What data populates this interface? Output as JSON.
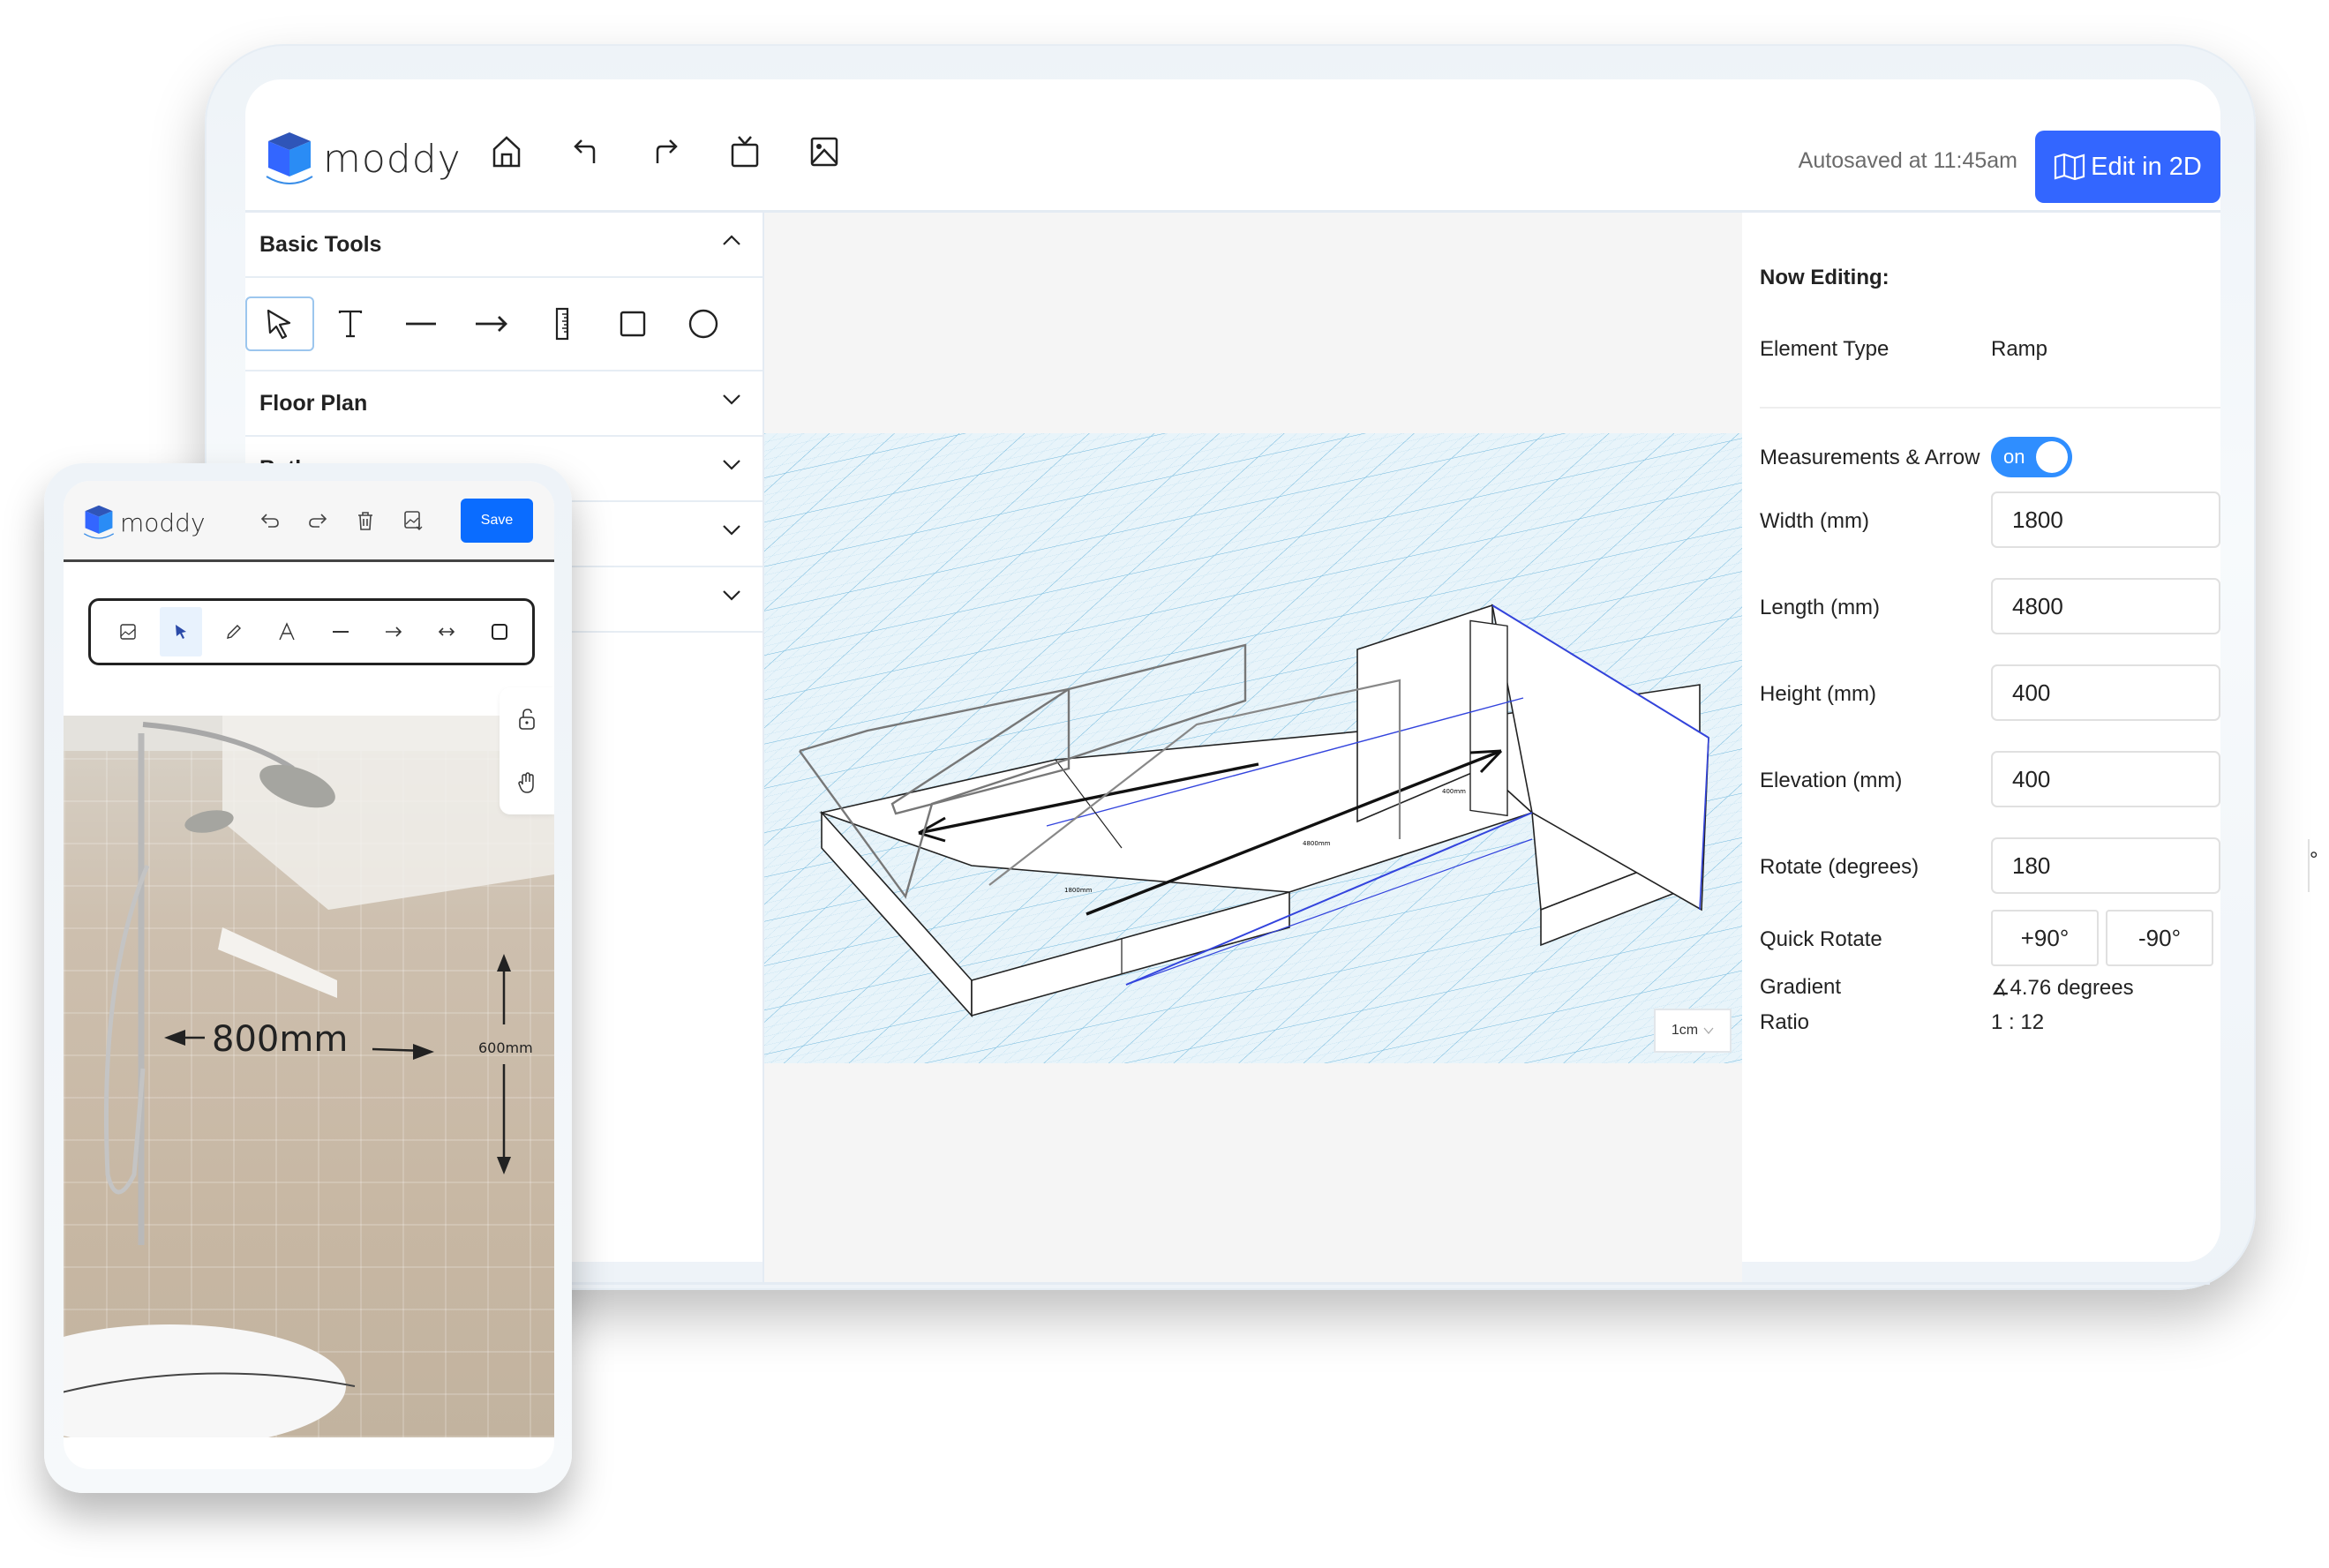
{
  "app": {
    "brand": "moddy",
    "brand_color": "#3366ff"
  },
  "header": {
    "icons": [
      "home-icon",
      "undo-icon",
      "redo-icon",
      "tv-icon",
      "image-icon"
    ],
    "autosave_text": "Autosaved at 11:45am",
    "edit_2d_label": "Edit in 2D",
    "edit_2d_icon": "map-icon"
  },
  "left_panel": {
    "sections": [
      {
        "label": "Basic Tools",
        "expanded": true
      },
      {
        "label": "Floor Plan",
        "expanded": false
      },
      {
        "label": "Bathroom",
        "expanded": false
      },
      {
        "label": "",
        "expanded": false
      },
      {
        "label": "",
        "expanded": false
      }
    ],
    "basic_tools": [
      {
        "icon": "select-cursor-icon",
        "active": true
      },
      {
        "icon": "text-icon",
        "active": false
      },
      {
        "icon": "line-icon",
        "active": false
      },
      {
        "icon": "arrow-icon",
        "active": false
      },
      {
        "icon": "ruler-icon",
        "active": false
      },
      {
        "icon": "rectangle-icon",
        "active": false
      },
      {
        "icon": "circle-icon",
        "active": false
      }
    ]
  },
  "canvas": {
    "scale_value": "1cm",
    "model_labels": [
      "400mm",
      "4800mm",
      "1800mm"
    ]
  },
  "right_panel": {
    "title": "Now Editing:",
    "element_type_label": "Element Type",
    "element_type_value": "Ramp",
    "measurements_label": "Measurements & Arrow",
    "measurements_toggle": "on",
    "fields": [
      {
        "label": "Width (mm)",
        "value": "1800"
      },
      {
        "label": "Length (mm)",
        "value": "4800"
      },
      {
        "label": "Height (mm)",
        "value": "400"
      },
      {
        "label": "Elevation (mm)",
        "value": "400"
      }
    ],
    "rotate_label": "Rotate (degrees)",
    "rotate_value": "180",
    "rotate_unit": "°",
    "quick_rotate_label": "Quick Rotate",
    "quick_rotate_plus": "+90°",
    "quick_rotate_minus": "-90°",
    "gradient_label": "Gradient",
    "gradient_value": "∡4.76 degrees",
    "ratio_label": "Ratio",
    "ratio_value": "1 : 12"
  },
  "phone": {
    "brand": "moddy",
    "header_icons": [
      "undo-icon",
      "redo-icon",
      "trash-icon",
      "export-image-icon"
    ],
    "save_label": "Save",
    "save_color": "#0a6cff",
    "tools": [
      {
        "icon": "image-icon",
        "active": false
      },
      {
        "icon": "select-cursor-icon",
        "active": true
      },
      {
        "icon": "pencil-icon",
        "active": false
      },
      {
        "icon": "text-icon",
        "active": false
      },
      {
        "icon": "line-icon",
        "active": false
      },
      {
        "icon": "arrow-icon",
        "active": false
      },
      {
        "icon": "double-arrow-icon",
        "active": false
      },
      {
        "icon": "rectangle-icon",
        "active": false
      }
    ],
    "side_tools": [
      "unlock-icon",
      "hand-icon"
    ],
    "photo_annotations": {
      "horizontal": "800mm",
      "vertical": "600mm"
    }
  }
}
